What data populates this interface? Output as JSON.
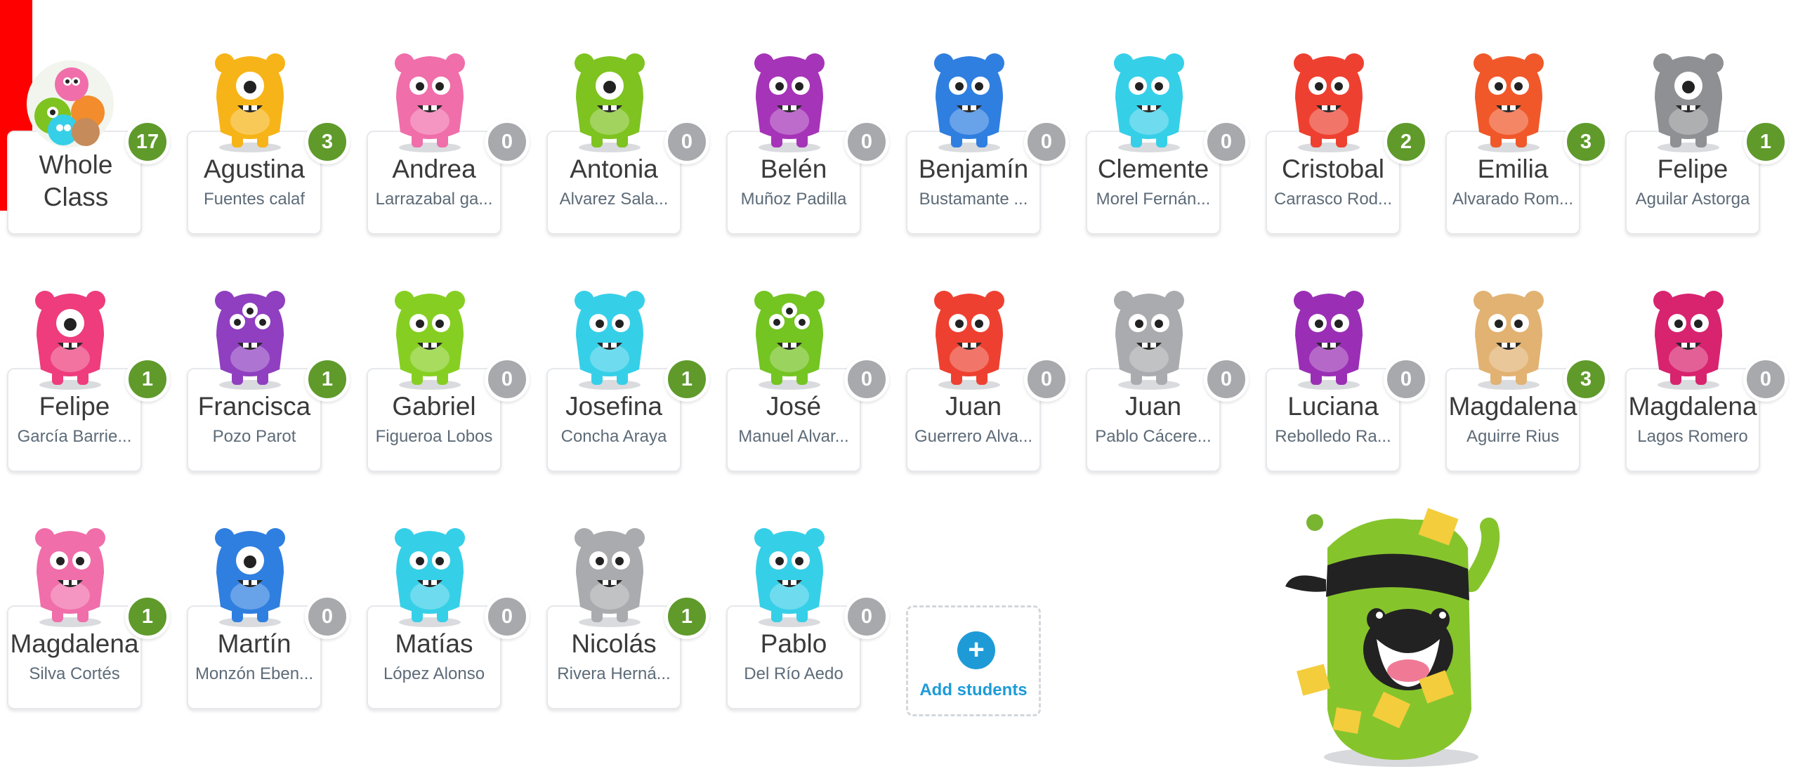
{
  "students": [
    {
      "first": "Whole Class",
      "last": "",
      "points": "17",
      "avatar": "whole-class-group",
      "whole": true
    },
    {
      "first": "Agustina",
      "last": "Fuentes calaf",
      "points": "3",
      "avatar": "yellow-cyclops-monster",
      "color": "#f7b418"
    },
    {
      "first": "Andrea",
      "last": "Larrazabal ga...",
      "points": "0",
      "avatar": "pink-bear-monster",
      "color": "#f06eaa"
    },
    {
      "first": "Antonia",
      "last": "Alvarez Sala...",
      "points": "0",
      "avatar": "green-cyclops-monster",
      "color": "#7ec320"
    },
    {
      "first": "Belén",
      "last": "Muñoz Padilla",
      "points": "0",
      "avatar": "purple-ghost-monster",
      "color": "#a634b8"
    },
    {
      "first": "Benjamín",
      "last": "Bustamante ...",
      "points": "0",
      "avatar": "blue-monster",
      "color": "#2f7fe0"
    },
    {
      "first": "Clemente",
      "last": "Morel Fernán...",
      "points": "0",
      "avatar": "cyan-fluffy-monster",
      "color": "#36cfe8"
    },
    {
      "first": "Cristobal",
      "last": "Carrasco Rod...",
      "points": "2",
      "avatar": "red-monster",
      "color": "#ee4030"
    },
    {
      "first": "Emilia",
      "last": "Alvarado Rom...",
      "points": "3",
      "avatar": "orange-antler-monster",
      "color": "#f0582a"
    },
    {
      "first": "Felipe",
      "last": "Aguilar Astorga",
      "points": "1",
      "avatar": "grey-cyclops-monster",
      "color": "#8e9093"
    },
    {
      "first": "Felipe",
      "last": "García Barrie...",
      "points": "1",
      "avatar": "pink-cyclops-monster",
      "color": "#ee3c7c"
    },
    {
      "first": "Francisca",
      "last": "Pozo Parot",
      "points": "1",
      "avatar": "purple-three-eyed-monster",
      "color": "#8f3fc0"
    },
    {
      "first": "Gabriel",
      "last": "Figueroa Lobos",
      "points": "0",
      "avatar": "green-antenna-monster",
      "color": "#86cf22"
    },
    {
      "first": "Josefina",
      "last": "Concha Araya",
      "points": "1",
      "avatar": "cyan-fluffy-monster",
      "color": "#36cfe8"
    },
    {
      "first": "José",
      "last": "Manuel Alvar...",
      "points": "0",
      "avatar": "green-three-eyed-monster",
      "color": "#74c422"
    },
    {
      "first": "Juan",
      "last": "Guerrero Alva...",
      "points": "0",
      "avatar": "red-monster",
      "color": "#ee4030"
    },
    {
      "first": "Juan",
      "last": "Pablo Cácere...",
      "points": "0",
      "avatar": "grey-cow-monster",
      "color": "#a9abae"
    },
    {
      "first": "Luciana",
      "last": "Rebolledo Ra...",
      "points": "0",
      "avatar": "purple-drip-monster",
      "color": "#9a2fb5"
    },
    {
      "first": "Magdalena",
      "last": "Aguirre Rius",
      "points": "3",
      "avatar": "calico-monster",
      "color": "#e2b272"
    },
    {
      "first": "Magdalena",
      "last": "Lagos Romero",
      "points": "0",
      "avatar": "magenta-monster",
      "color": "#d8236f"
    },
    {
      "first": "Magdalena",
      "last": "Silva Cortés",
      "points": "1",
      "avatar": "pink-bear-monster",
      "color": "#f06eaa"
    },
    {
      "first": "Martín",
      "last": "Monzón Eben...",
      "points": "0",
      "avatar": "blue-cyclops-monster",
      "color": "#2f7fe0"
    },
    {
      "first": "Matías",
      "last": "López Alonso",
      "points": "0",
      "avatar": "cyan-fluffy-monster",
      "color": "#36cfe8"
    },
    {
      "first": "Nicolás",
      "last": "Rivera Herná...",
      "points": "1",
      "avatar": "grey-cow-monster",
      "color": "#a9abae"
    },
    {
      "first": "Pablo",
      "last": "Del Río Aedo",
      "points": "0",
      "avatar": "cyan-fluffy-monster",
      "color": "#36cfe8"
    }
  ],
  "add_students": {
    "label": "Add students"
  },
  "badge_colors": {
    "positive": "#5f9a2b",
    "zero": "#a7a9ac"
  },
  "accent": "#1e9bd7",
  "mascot": "green-ninja-monster-mascot"
}
